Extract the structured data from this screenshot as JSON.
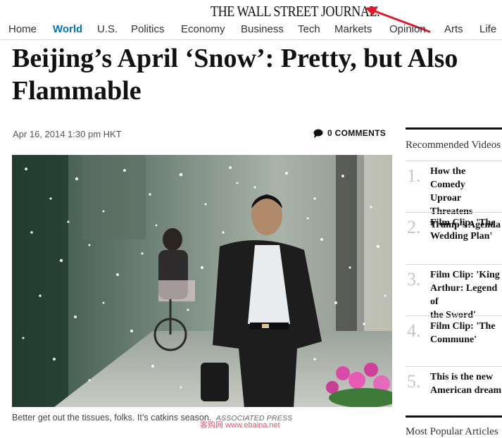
{
  "header": {
    "logo": "THE WALL STREET JOURNAL."
  },
  "nav": {
    "items": [
      "Home",
      "World",
      "U.S.",
      "Politics",
      "Economy",
      "Business",
      "Tech",
      "Markets",
      "Opinion",
      "Arts",
      "Life"
    ],
    "active": "World"
  },
  "article": {
    "headline": "Beijing’s April ‘Snow’: Pretty, but Also Flammable",
    "dateline": "Apr 16, 2014 1:30 pm HKT",
    "comments": "0 COMMENTS",
    "caption": "Better get out the tissues, folks. It’s catkins season.",
    "credit": "ASSOCIATED PRESS"
  },
  "sidebar": {
    "title": "Recommended Videos",
    "items": [
      {
        "number": "1.",
        "text": "How the Comedy\nUproar Threatens\nTrump’s Agenda"
      },
      {
        "number": "2.",
        "text": "Film Clip: 'The\nWedding Plan'"
      },
      {
        "number": "3.",
        "text": "Film Clip: 'King\nArthur: Legend of\nthe Sword'"
      },
      {
        "number": "4.",
        "text": "Film Clip: 'The\nCommune'"
      },
      {
        "number": "5.",
        "text": "This is the new\nAmerican dream"
      }
    ],
    "next_title": "Most Popular Articles"
  },
  "watermark": "客购网 www.ebaina.net",
  "colors": {
    "accent": "#0274b6",
    "arrow": "#e0192d",
    "watermark": "#e8506b"
  }
}
